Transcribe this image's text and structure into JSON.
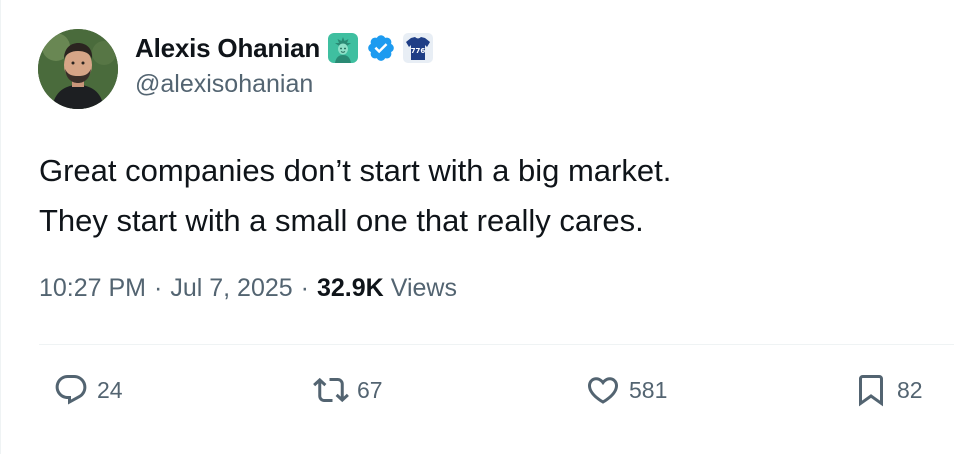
{
  "author": {
    "display_name": "Alexis Ohanian",
    "handle": "@alexisohanian",
    "avatar_icon": "avatar-photo",
    "badges": [
      "statue-of-liberty-icon",
      "verified-badge-icon",
      "jersey-776-icon"
    ],
    "jersey_number": "776"
  },
  "tweet": {
    "lines": [
      "Great companies don’t start with a big market.",
      "They start with a small one that really cares."
    ],
    "time": "10:27 PM",
    "date": "Jul 7, 2025",
    "separator": "·",
    "views_count": "32.9K",
    "views_label": "Views"
  },
  "actions": {
    "replies": "24",
    "reposts": "67",
    "likes": "581",
    "bookmarks": "82"
  },
  "colors": {
    "text": "#0f1419",
    "secondary": "#536471",
    "verified": "#1d9bf0",
    "divider": "#eff3f4"
  }
}
